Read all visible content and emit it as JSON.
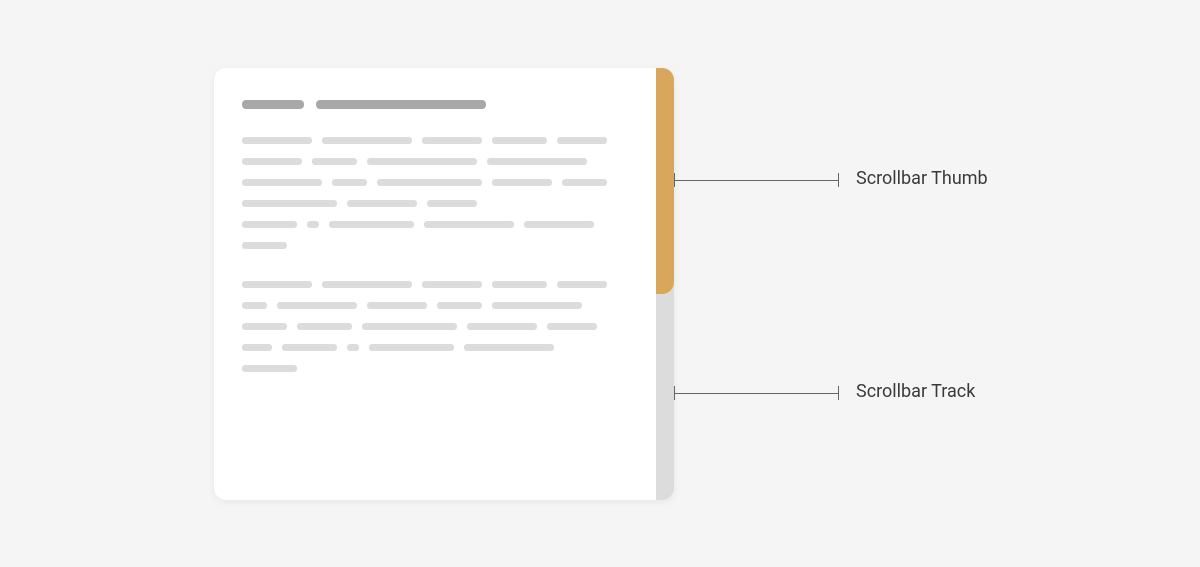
{
  "labels": {
    "thumb": "Scrollbar Thumb",
    "track": "Scrollbar Track"
  },
  "colors": {
    "thumb": "#d9a75c",
    "track": "#dcdcdc",
    "panel": "#ffffff",
    "placeholder_heading": "#a8a8a8",
    "placeholder_text": "#dcdcdc"
  }
}
